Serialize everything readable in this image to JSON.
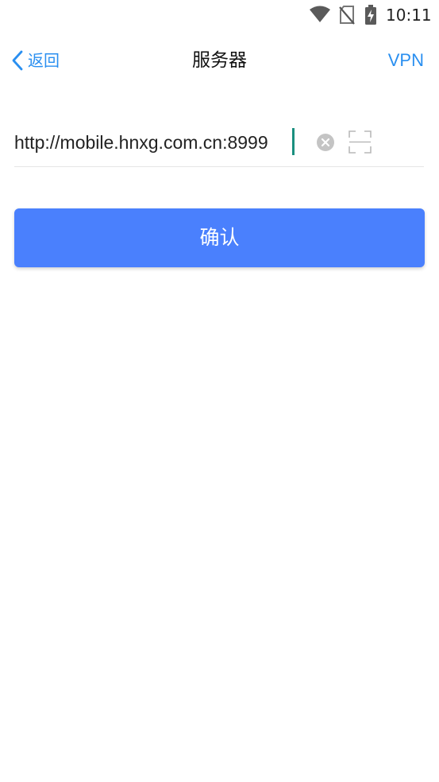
{
  "status_bar": {
    "time": "10:11",
    "icons": [
      "wifi-icon",
      "no-sim-icon",
      "battery-charging-icon"
    ]
  },
  "nav": {
    "back_label": "返回",
    "back_icon": "chevron-left-icon",
    "title": "服务器",
    "vpn_label": "VPN"
  },
  "server": {
    "value": "http://mobile.hnxg.com.cn:8999",
    "clear_icon": "clear-circle-icon",
    "scan_icon": "scan-icon"
  },
  "confirm": {
    "label": "确认"
  },
  "colors": {
    "accent": "#2a8ff0",
    "button": "#4a80fd",
    "cursor": "#1a8f7f",
    "divider": "#e6e6e6"
  }
}
